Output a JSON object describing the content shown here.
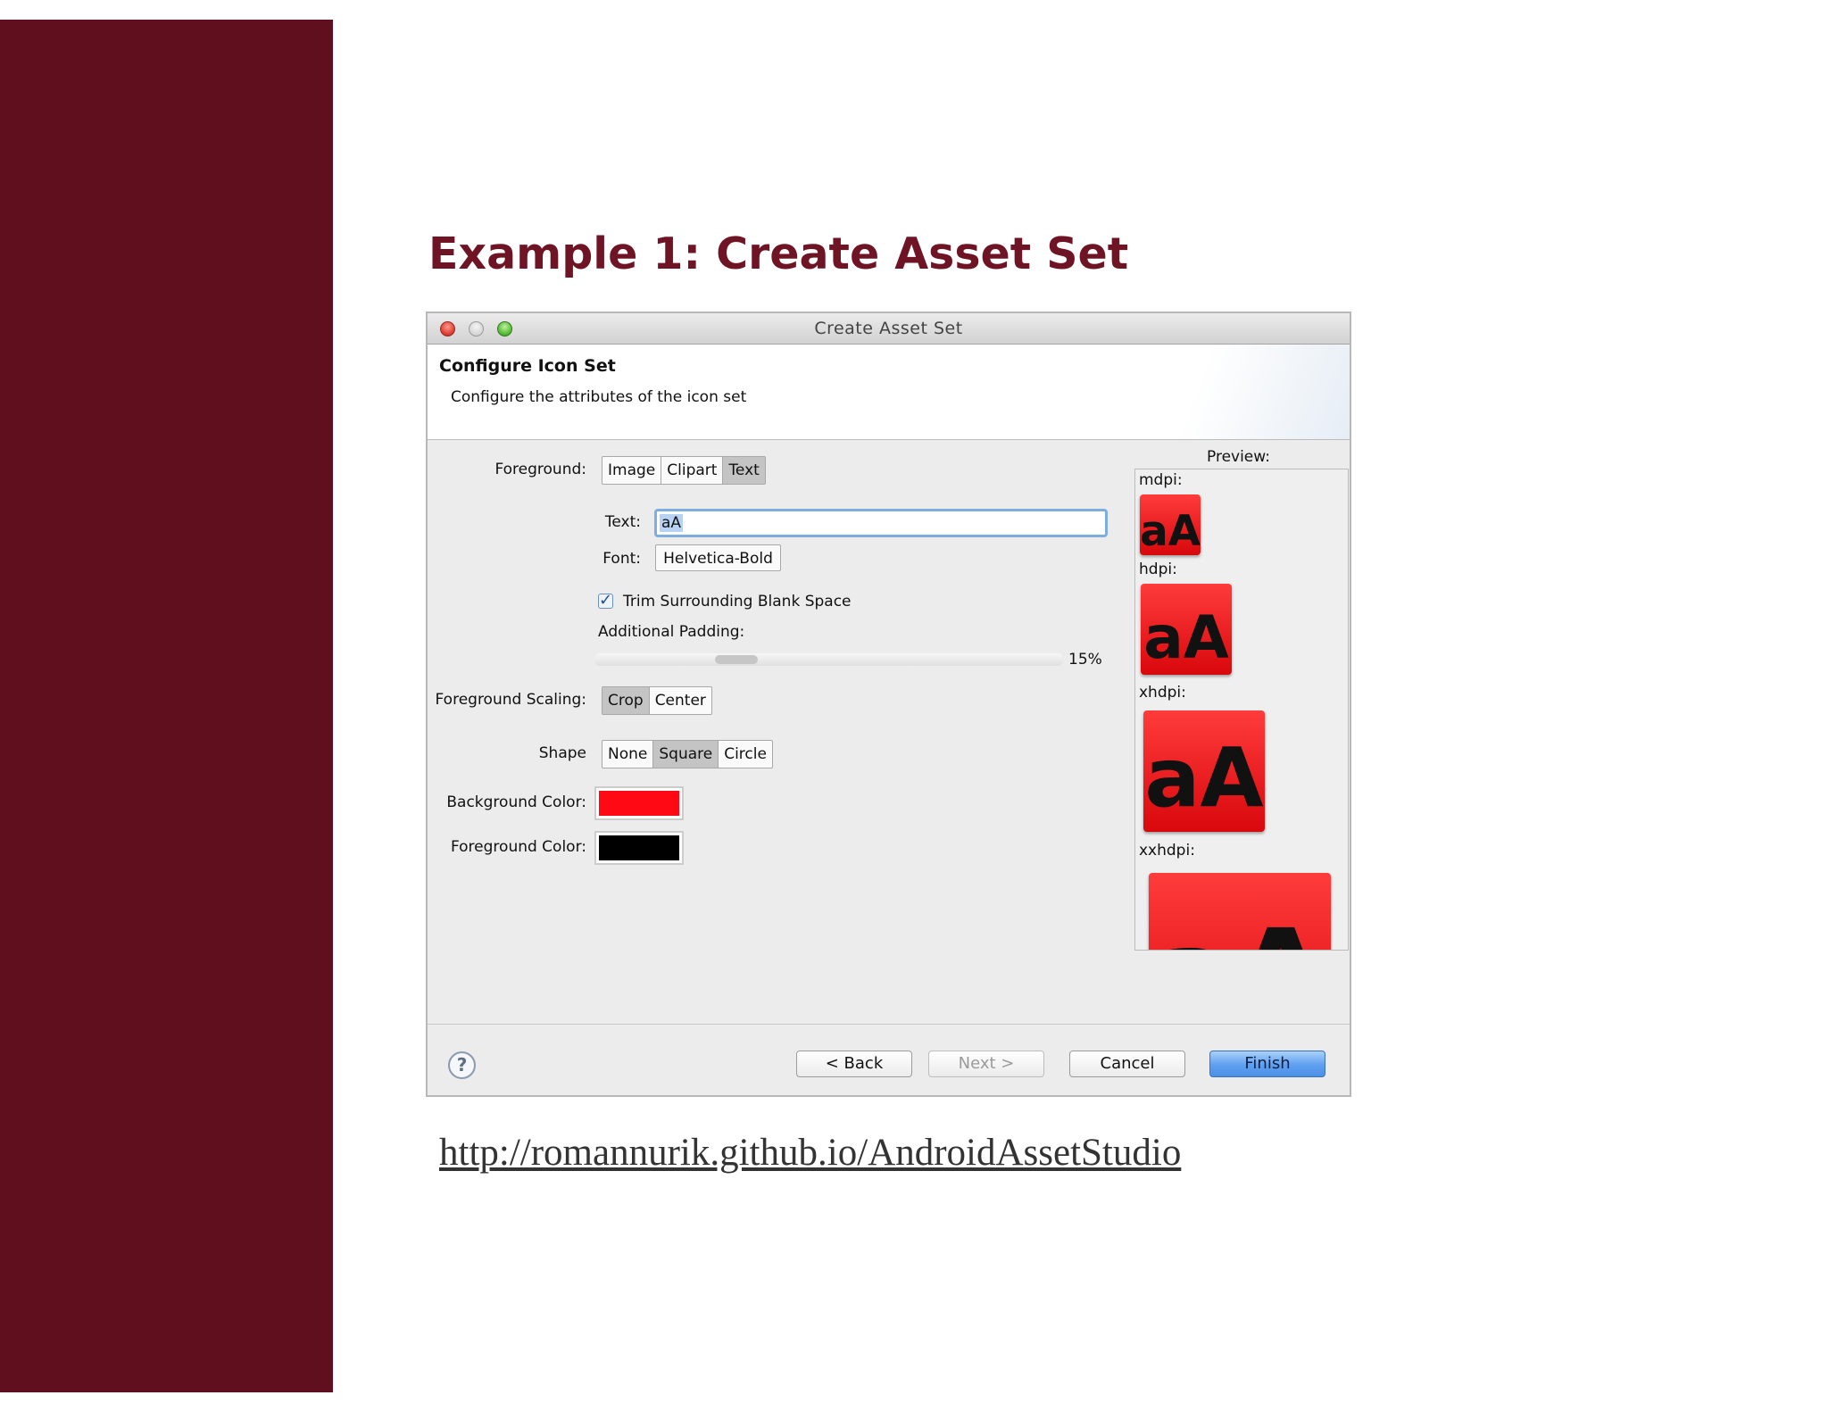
{
  "slide": {
    "title": "Example 1:  Create Asset Set",
    "link": "http://romannurik.github.io/AndroidAssetStudio",
    "sidebar_color": "#5f0f1e",
    "title_color": "#6e1425"
  },
  "window": {
    "title": "Create Asset Set"
  },
  "header": {
    "title": "Configure Icon Set",
    "subtitle": "Configure the attributes of the icon set"
  },
  "form": {
    "foreground_label": "Foreground:",
    "foreground_options": [
      "Image",
      "Clipart",
      "Text"
    ],
    "foreground_selected": "Text",
    "text_label": "Text:",
    "text_value": "aA",
    "font_label": "Font:",
    "font_value": "Helvetica-Bold",
    "trim_label": "Trim Surrounding Blank Space",
    "trim_checked": true,
    "padding_label": "Additional Padding:",
    "padding_value": "15%",
    "padding_fraction": 0.15,
    "scaling_label": "Foreground Scaling:",
    "scaling_options": [
      "Crop",
      "Center"
    ],
    "scaling_selected": "Crop",
    "shape_label": "Shape",
    "shape_options": [
      "None",
      "Square",
      "Circle"
    ],
    "shape_selected": "Square",
    "bg_color_label": "Background Color:",
    "bg_color": "#ff0a14",
    "fg_color_label": "Foreground Color:",
    "fg_color": "#000000"
  },
  "preview": {
    "label": "Preview:",
    "icon_text": "aA",
    "densities": [
      "mdpi:",
      "hdpi:",
      "xhdpi:",
      "xxhdpi:"
    ]
  },
  "footer": {
    "help_icon": "?",
    "back": "< Back",
    "next": "Next >",
    "cancel": "Cancel",
    "finish": "Finish"
  }
}
